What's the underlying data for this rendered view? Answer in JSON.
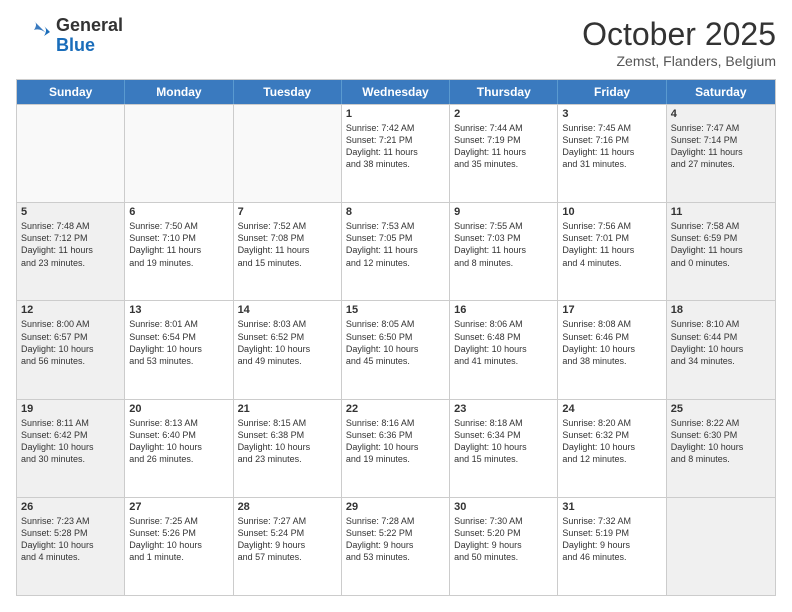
{
  "header": {
    "logo_general": "General",
    "logo_blue": "Blue",
    "month_title": "October 2025",
    "subtitle": "Zemst, Flanders, Belgium"
  },
  "days_of_week": [
    "Sunday",
    "Monday",
    "Tuesday",
    "Wednesday",
    "Thursday",
    "Friday",
    "Saturday"
  ],
  "weeks": [
    [
      {
        "day": "",
        "info": "",
        "empty": true
      },
      {
        "day": "",
        "info": "",
        "empty": true
      },
      {
        "day": "",
        "info": "",
        "empty": true
      },
      {
        "day": "1",
        "info": "Sunrise: 7:42 AM\nSunset: 7:21 PM\nDaylight: 11 hours\nand 38 minutes.",
        "empty": false
      },
      {
        "day": "2",
        "info": "Sunrise: 7:44 AM\nSunset: 7:19 PM\nDaylight: 11 hours\nand 35 minutes.",
        "empty": false
      },
      {
        "day": "3",
        "info": "Sunrise: 7:45 AM\nSunset: 7:16 PM\nDaylight: 11 hours\nand 31 minutes.",
        "empty": false
      },
      {
        "day": "4",
        "info": "Sunrise: 7:47 AM\nSunset: 7:14 PM\nDaylight: 11 hours\nand 27 minutes.",
        "empty": false,
        "shaded": true
      }
    ],
    [
      {
        "day": "5",
        "info": "Sunrise: 7:48 AM\nSunset: 7:12 PM\nDaylight: 11 hours\nand 23 minutes.",
        "empty": false,
        "shaded": true
      },
      {
        "day": "6",
        "info": "Sunrise: 7:50 AM\nSunset: 7:10 PM\nDaylight: 11 hours\nand 19 minutes.",
        "empty": false
      },
      {
        "day": "7",
        "info": "Sunrise: 7:52 AM\nSunset: 7:08 PM\nDaylight: 11 hours\nand 15 minutes.",
        "empty": false
      },
      {
        "day": "8",
        "info": "Sunrise: 7:53 AM\nSunset: 7:05 PM\nDaylight: 11 hours\nand 12 minutes.",
        "empty": false
      },
      {
        "day": "9",
        "info": "Sunrise: 7:55 AM\nSunset: 7:03 PM\nDaylight: 11 hours\nand 8 minutes.",
        "empty": false
      },
      {
        "day": "10",
        "info": "Sunrise: 7:56 AM\nSunset: 7:01 PM\nDaylight: 11 hours\nand 4 minutes.",
        "empty": false
      },
      {
        "day": "11",
        "info": "Sunrise: 7:58 AM\nSunset: 6:59 PM\nDaylight: 11 hours\nand 0 minutes.",
        "empty": false,
        "shaded": true
      }
    ],
    [
      {
        "day": "12",
        "info": "Sunrise: 8:00 AM\nSunset: 6:57 PM\nDaylight: 10 hours\nand 56 minutes.",
        "empty": false,
        "shaded": true
      },
      {
        "day": "13",
        "info": "Sunrise: 8:01 AM\nSunset: 6:54 PM\nDaylight: 10 hours\nand 53 minutes.",
        "empty": false
      },
      {
        "day": "14",
        "info": "Sunrise: 8:03 AM\nSunset: 6:52 PM\nDaylight: 10 hours\nand 49 minutes.",
        "empty": false
      },
      {
        "day": "15",
        "info": "Sunrise: 8:05 AM\nSunset: 6:50 PM\nDaylight: 10 hours\nand 45 minutes.",
        "empty": false
      },
      {
        "day": "16",
        "info": "Sunrise: 8:06 AM\nSunset: 6:48 PM\nDaylight: 10 hours\nand 41 minutes.",
        "empty": false
      },
      {
        "day": "17",
        "info": "Sunrise: 8:08 AM\nSunset: 6:46 PM\nDaylight: 10 hours\nand 38 minutes.",
        "empty": false
      },
      {
        "day": "18",
        "info": "Sunrise: 8:10 AM\nSunset: 6:44 PM\nDaylight: 10 hours\nand 34 minutes.",
        "empty": false,
        "shaded": true
      }
    ],
    [
      {
        "day": "19",
        "info": "Sunrise: 8:11 AM\nSunset: 6:42 PM\nDaylight: 10 hours\nand 30 minutes.",
        "empty": false,
        "shaded": true
      },
      {
        "day": "20",
        "info": "Sunrise: 8:13 AM\nSunset: 6:40 PM\nDaylight: 10 hours\nand 26 minutes.",
        "empty": false
      },
      {
        "day": "21",
        "info": "Sunrise: 8:15 AM\nSunset: 6:38 PM\nDaylight: 10 hours\nand 23 minutes.",
        "empty": false
      },
      {
        "day": "22",
        "info": "Sunrise: 8:16 AM\nSunset: 6:36 PM\nDaylight: 10 hours\nand 19 minutes.",
        "empty": false
      },
      {
        "day": "23",
        "info": "Sunrise: 8:18 AM\nSunset: 6:34 PM\nDaylight: 10 hours\nand 15 minutes.",
        "empty": false
      },
      {
        "day": "24",
        "info": "Sunrise: 8:20 AM\nSunset: 6:32 PM\nDaylight: 10 hours\nand 12 minutes.",
        "empty": false
      },
      {
        "day": "25",
        "info": "Sunrise: 8:22 AM\nSunset: 6:30 PM\nDaylight: 10 hours\nand 8 minutes.",
        "empty": false,
        "shaded": true
      }
    ],
    [
      {
        "day": "26",
        "info": "Sunrise: 7:23 AM\nSunset: 5:28 PM\nDaylight: 10 hours\nand 4 minutes.",
        "empty": false,
        "shaded": true
      },
      {
        "day": "27",
        "info": "Sunrise: 7:25 AM\nSunset: 5:26 PM\nDaylight: 10 hours\nand 1 minute.",
        "empty": false
      },
      {
        "day": "28",
        "info": "Sunrise: 7:27 AM\nSunset: 5:24 PM\nDaylight: 9 hours\nand 57 minutes.",
        "empty": false
      },
      {
        "day": "29",
        "info": "Sunrise: 7:28 AM\nSunset: 5:22 PM\nDaylight: 9 hours\nand 53 minutes.",
        "empty": false
      },
      {
        "day": "30",
        "info": "Sunrise: 7:30 AM\nSunset: 5:20 PM\nDaylight: 9 hours\nand 50 minutes.",
        "empty": false
      },
      {
        "day": "31",
        "info": "Sunrise: 7:32 AM\nSunset: 5:19 PM\nDaylight: 9 hours\nand 46 minutes.",
        "empty": false
      },
      {
        "day": "",
        "info": "",
        "empty": true,
        "shaded": true
      }
    ]
  ]
}
